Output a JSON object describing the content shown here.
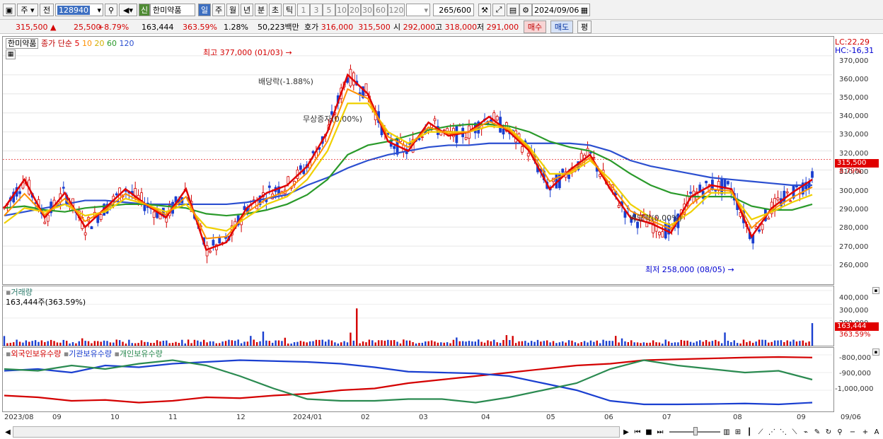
{
  "toolbar": {
    "market": "주",
    "prev": "전",
    "code": "128940",
    "stock_flag": "신",
    "stock_name": "한미약품",
    "periods": [
      "일",
      "주",
      "월",
      "년",
      "분",
      "초",
      "틱"
    ],
    "minute_nums": [
      "1",
      "3",
      "5",
      "10",
      "20",
      "30",
      "60",
      "120"
    ],
    "count": "265",
    "count_max": "/600",
    "date": "2024/09/06"
  },
  "quote": {
    "price": "315,500",
    "arrow": "▲",
    "change": "25,500",
    "change_pct": "+8.79%",
    "volume": "163,444",
    "volume_pct": "363.59%",
    "turnover": "1.28%",
    "amount": "50,223백만",
    "ask_label": "호가",
    "ask": "316,000",
    "bid": "315,500",
    "open_label": "시",
    "open": "292,000",
    "high_label": "고",
    "high": "318,000",
    "low_label": "저",
    "low": "291,000",
    "buy": "매수",
    "sell": "매도",
    "avg": "평"
  },
  "legend": {
    "name": "한미약품",
    "ma_title": "종가 단순",
    "ma": [
      "5",
      "10",
      "20",
      "60",
      "120"
    ],
    "ma_colors": [
      "#e00000",
      "#ff9000",
      "#e0c000",
      "#2a9a2a",
      "#2b4fd0"
    ]
  },
  "annotations": {
    "high": "최고 377,000 (01/03)",
    "low": "최저 258,000 (08/05)",
    "div1": "배당락(-1.88%)",
    "bonus": "무상증자(0.00%)",
    "div2": "배당락(0.00%)"
  },
  "side": {
    "lc": "LC:22,29",
    "hc": "HC:-16,31"
  },
  "price_axis": [
    "370,000",
    "360,000",
    "350,000",
    "340,000",
    "330,000",
    "320,000",
    "310,000",
    "300,000",
    "290,000",
    "280,000",
    "270,000",
    "260,000"
  ],
  "price_tag": "315,500",
  "price_tag_pct": "8.79%",
  "volume_panel": {
    "title": "거래량",
    "info": "163,444주(363.59%)",
    "axis": [
      "400,000",
      "300,000",
      "200,000"
    ],
    "tag": "163,444",
    "tag_pct": "363.59%"
  },
  "holdings_panel": {
    "legend": [
      "외국인보유수량",
      "기관보유수량",
      "개인보유수량"
    ],
    "axis": [
      "-800,000",
      "-900,000",
      "-1,000,000"
    ]
  },
  "x_axis": [
    "2023/08",
    "09",
    "10",
    "11",
    "12",
    "2024/01",
    "02",
    "03",
    "04",
    "05",
    "06",
    "07",
    "08",
    "09"
  ],
  "x_end": "09/06",
  "chart_data": {
    "type": "candlestick",
    "symbol": "한미약품",
    "ylim": [
      250000,
      380000
    ],
    "last": {
      "open": 292000,
      "high": 318000,
      "low": 291000,
      "close": 315500,
      "volume": 163444
    },
    "annotations": [
      {
        "label": "최고",
        "value": 377000,
        "date": "01/03"
      },
      {
        "label": "최저",
        "value": 258000,
        "date": "08/05"
      }
    ],
    "series": [
      {
        "name": "5",
        "values": [
          290000,
          305000,
          285000,
          298000,
          280000,
          290000,
          300000,
          292000,
          285000,
          300000,
          268000,
          272000,
          290000,
          298000,
          302000,
          312000,
          330000,
          360000,
          350000,
          325000,
          320000,
          335000,
          328000,
          330000,
          338000,
          330000,
          320000,
          300000,
          310000,
          318000,
          300000,
          285000,
          282000,
          277000,
          296000,
          302000,
          300000,
          275000,
          290000,
          298000,
          305000
        ]
      },
      {
        "name": "20",
        "values": [
          282000,
          290000,
          288000,
          292000,
          286000,
          288000,
          295000,
          292000,
          288000,
          292000,
          280000,
          278000,
          285000,
          292000,
          296000,
          305000,
          320000,
          345000,
          345000,
          330000,
          324000,
          330000,
          330000,
          330000,
          333000,
          332000,
          322000,
          308000,
          308000,
          315000,
          305000,
          292000,
          285000,
          281000,
          288000,
          298000,
          298000,
          284000,
          288000,
          293000,
          297000
        ]
      },
      {
        "name": "60",
        "values": [
          290000,
          291000,
          289000,
          288000,
          290000,
          291000,
          292000,
          292000,
          291000,
          290000,
          287000,
          286000,
          287000,
          289000,
          292000,
          297000,
          305000,
          318000,
          323000,
          325000,
          328000,
          331000,
          333000,
          334000,
          334000,
          333000,
          330000,
          325000,
          322000,
          320000,
          315000,
          308000,
          302000,
          298000,
          296000,
          296000,
          296000,
          291000,
          289000,
          289000,
          292000
        ]
      },
      {
        "name": "120",
        "values": [
          286000,
          288000,
          290000,
          292000,
          294000,
          294000,
          293000,
          292000,
          292000,
          292000,
          292000,
          292000,
          293000,
          295000,
          297000,
          302000,
          306000,
          311000,
          315000,
          318000,
          320000,
          322000,
          323000,
          323000,
          324000,
          324000,
          324000,
          324000,
          324000,
          323000,
          320000,
          315000,
          312000,
          310000,
          308000,
          306000,
          305000,
          304000,
          303000,
          302000,
          302000
        ]
      }
    ],
    "volume_ylim": [
      0,
      430000
    ]
  }
}
